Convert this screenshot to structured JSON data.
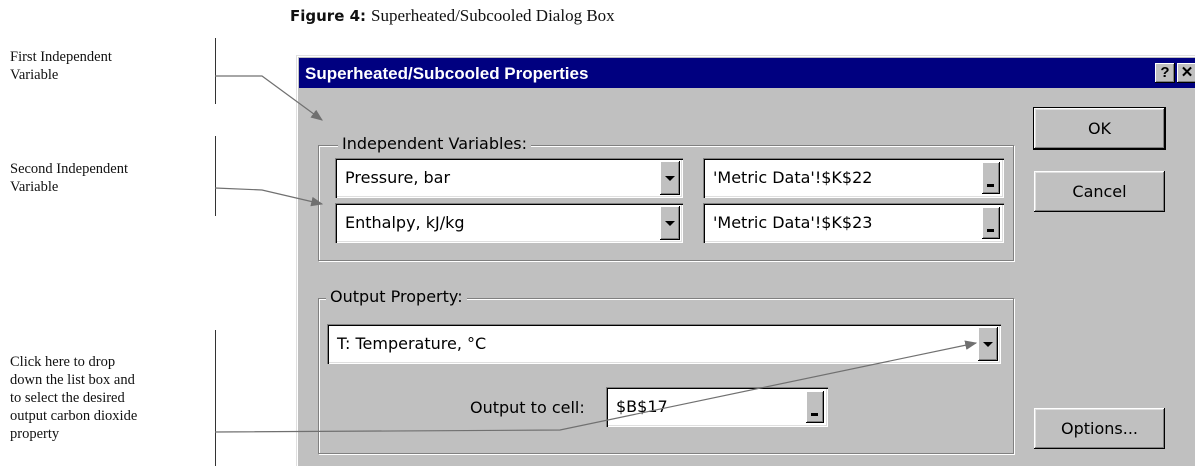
{
  "caption": {
    "figure": "Figure 4:",
    "text": "Superheated/Subcooled Dialog Box"
  },
  "annotations": {
    "first": [
      "First Independent",
      "Variable"
    ],
    "second": [
      "Second Independent",
      "Variable"
    ],
    "third": [
      "Click here to drop",
      "down the list box and",
      "to select the desired",
      "output carbon dioxide",
      "property"
    ]
  },
  "dialog": {
    "title": "Superheated/Subcooled Properties",
    "help_glyph": "?",
    "close_glyph": "✕",
    "independent_group_label": "Independent Variables:",
    "var1": {
      "selected": "Pressure, bar",
      "ref": "'Metric Data'!$K$22"
    },
    "var2": {
      "selected": "Enthalpy, kJ/kg",
      "ref": "'Metric Data'!$K$23"
    },
    "output_group_label": "Output Property:",
    "output_property": "T: Temperature, °C",
    "output_cell_label": "Output to cell:",
    "output_cell_value": "$B$17",
    "buttons": {
      "ok": "OK",
      "cancel": "Cancel",
      "options": "Options..."
    }
  }
}
